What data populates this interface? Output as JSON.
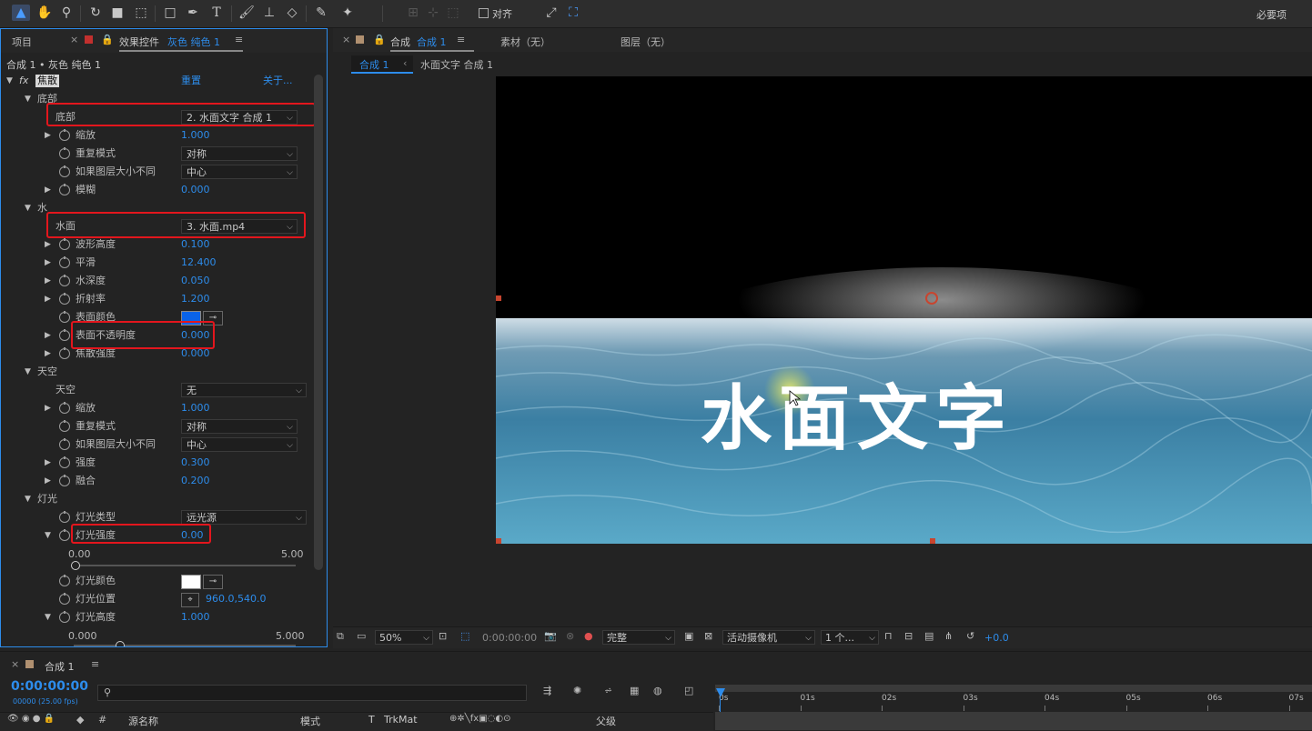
{
  "toolbar": {
    "snap_label": "对齐",
    "workspace_label": "必要项"
  },
  "left_panel": {
    "tab_project": "项目",
    "tab_effects": "效果控件",
    "tab_effects_layer": "灰色 纯色 1",
    "breadcrumb": "合成 1 • 灰色 纯色 1",
    "effect_name": "焦散",
    "reset": "重置",
    "about": "关于..."
  },
  "props": {
    "bottom_group": "底部",
    "bottom_layer_label": "底部",
    "bottom_layer_value": "2. 水面文字 合成 1",
    "scale_label": "缩放",
    "scale_value": "1.000",
    "repeat_label": "重复模式",
    "repeat_value": "对称",
    "size_diff_label": "如果图层大小不同",
    "size_diff_value": "中心",
    "blur_label": "模糊",
    "blur_value": "0.000",
    "water_group": "水",
    "water_surface_label": "水面",
    "water_surface_value": "3. 水面.mp4",
    "wave_height_label": "波形高度",
    "wave_height_value": "0.100",
    "smooth_label": "平滑",
    "smooth_value": "12.400",
    "depth_label": "水深度",
    "depth_value": "0.050",
    "refraction_label": "折射率",
    "refraction_value": "1.200",
    "surface_color_label": "表面颜色",
    "surface_color": "#0a63e8",
    "surface_opacity_label": "表面不透明度",
    "surface_opacity_value": "0.000",
    "caustics_label": "焦散强度",
    "caustics_value": "0.000",
    "sky_group": "天空",
    "sky_label": "天空",
    "sky_value": "无",
    "sky_scale_label": "缩放",
    "sky_scale_value": "1.000",
    "sky_repeat_label": "重复模式",
    "sky_repeat_value": "对称",
    "sky_size_diff_label": "如果图层大小不同",
    "sky_size_diff_value": "中心",
    "intensity_label": "强度",
    "intensity_value": "0.300",
    "blend_label": "融合",
    "blend_value": "0.200",
    "light_group": "灯光",
    "light_type_label": "灯光类型",
    "light_type_value": "远光源",
    "light_intensity_label": "灯光强度",
    "light_intensity_value": "0.00",
    "light_slider_min": "0.00",
    "light_slider_max": "5.00",
    "light_color_label": "灯光颜色",
    "light_color": "#ffffff",
    "light_pos_label": "灯光位置",
    "light_pos_value": "960.0,540.0",
    "light_height_label": "灯光高度",
    "light_height_value": "1.000",
    "height_slider_min": "0.000",
    "height_slider_max": "5.000"
  },
  "viewer": {
    "tab_comp": "合成",
    "tab_comp_name": "合成 1",
    "tab_footage": "素材（无）",
    "tab_layer": "图层（无）",
    "crumb_comp": "合成 1",
    "crumb_sub": "水面文字 合成 1",
    "overlay_text": "水面文字",
    "zoom": "50%",
    "timecode": "0:00:00:00",
    "quality": "完整",
    "camera": "活动摄像机",
    "views": "1 个...",
    "exposure": "+0.0"
  },
  "timeline": {
    "tab_label": "合成 1",
    "timecode": "0:00:00:00",
    "fps": "00000 (25.00 fps)",
    "col_source": "源名称",
    "col_mode": "模式",
    "col_t": "T",
    "col_trkmat": "TrkMat",
    "col_parent": "父级",
    "ruler": [
      "0s",
      "01s",
      "02s",
      "03s",
      "04s",
      "05s",
      "06s",
      "07s"
    ]
  }
}
